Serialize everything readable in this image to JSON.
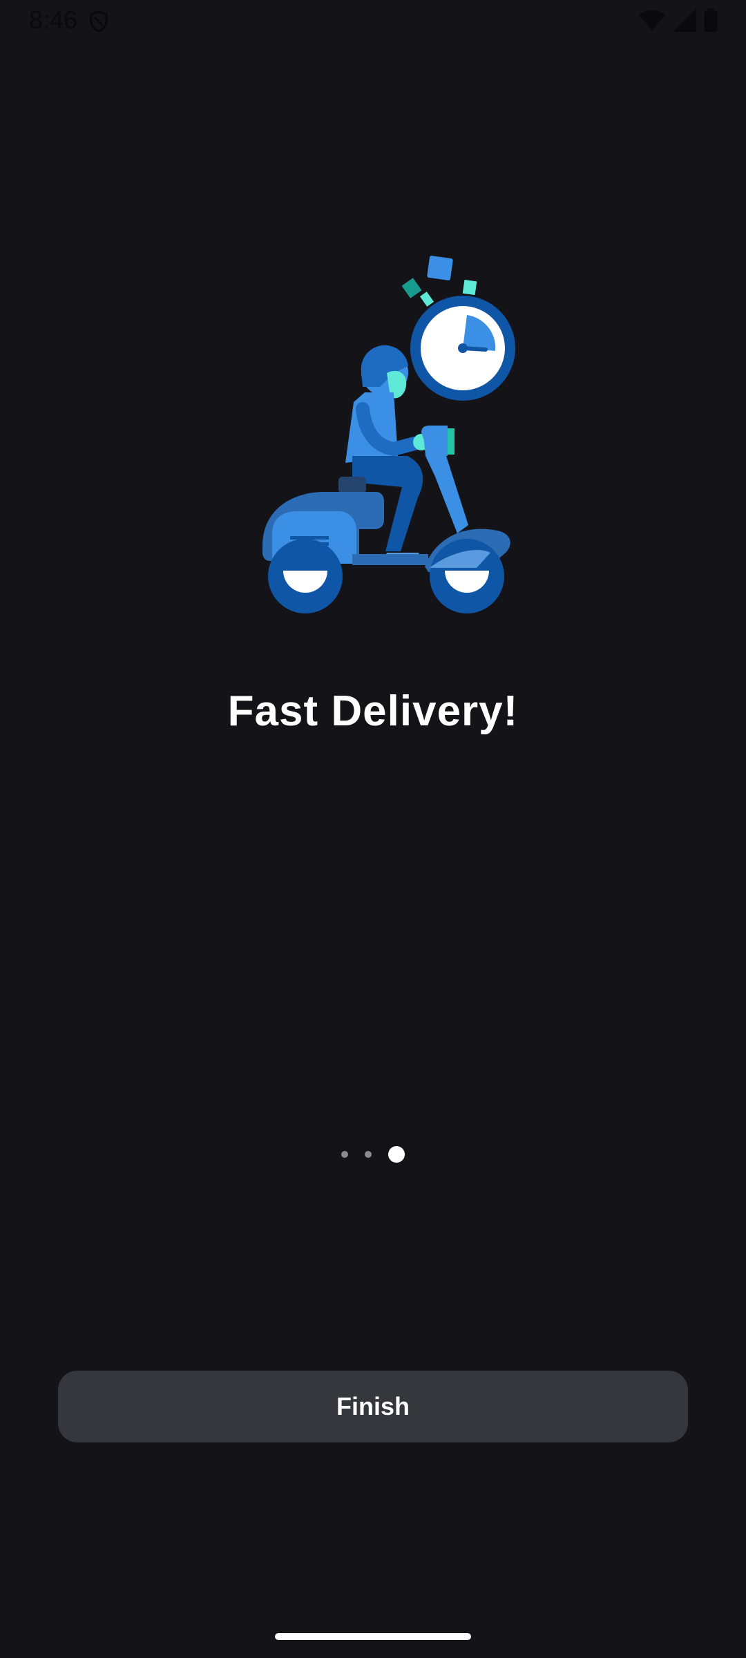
{
  "status_bar": {
    "time": "8:46",
    "icons": [
      "shield-icon",
      "wifi-icon",
      "signal-icon",
      "battery-icon"
    ]
  },
  "onboarding": {
    "illustration": "scooter-delivery-with-stopwatch",
    "title": "Fast Delivery!",
    "page_count": 3,
    "current_page": 3
  },
  "actions": {
    "finish_label": "Finish"
  },
  "colors": {
    "background": "#131318",
    "button": "#36363d",
    "accent_blue": "#3b8fe4",
    "accent_dark_blue": "#0f57a6",
    "accent_teal": "#5ee8d6"
  }
}
